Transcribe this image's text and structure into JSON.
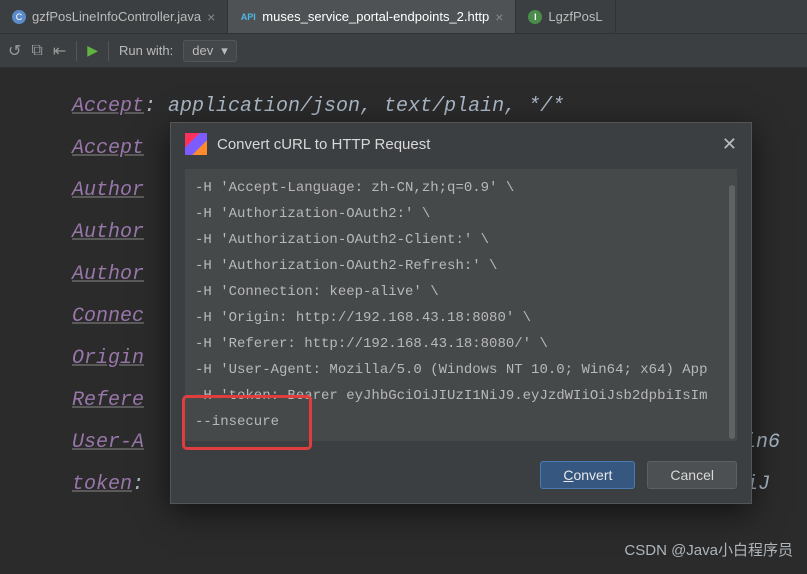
{
  "tabs": {
    "t0": {
      "label": "gzfPosLineInfoController.java"
    },
    "t1": {
      "label": "muses_service_portal-endpoints_2.http",
      "icon_text": "API"
    },
    "t2": {
      "label": "LgzfPosL"
    }
  },
  "toolbar": {
    "run_with_label": "Run with:",
    "run_config": "dev"
  },
  "editor": {
    "l0_k": "Accept",
    "l0_v": ": application/json, text/plain, */*",
    "l1_k": "Accept",
    "l2_k": "Author",
    "l3_k": "Author",
    "l4_k": "Author",
    "l5_k": "Connec",
    "l6_k": "Origin",
    "l7_k": "Refere",
    "l8_k": "User-A",
    "l8_v": "in6",
    "l9_k": "token",
    "l9_v": ":",
    "l9_end": "DiJ"
  },
  "dialog": {
    "title": "Convert cURL to HTTP Request",
    "lines": {
      "c0": "  -H 'Accept-Language: zh-CN,zh;q=0.9' \\",
      "c1": "  -H 'Authorization-OAuth2:' \\",
      "c2": "  -H 'Authorization-OAuth2-Client:' \\",
      "c3": "  -H 'Authorization-OAuth2-Refresh:' \\",
      "c4": "  -H 'Connection: keep-alive' \\",
      "c5": "  -H 'Origin: http://192.168.43.18:8080' \\",
      "c6": "  -H 'Referer: http://192.168.43.18:8080/' \\",
      "c7": "  -H 'User-Agent: Mozilla/5.0 (Windows NT 10.0; Win64; x64) App",
      "c8": "  -H 'token: Bearer eyJhbGciOiJIUzI1NiJ9.eyJzdWIiOiJsb2dpbiIsIm",
      "c9": "  --insecure"
    },
    "convert_label": "Convert",
    "cancel_label": "Cancel"
  },
  "watermark": "CSDN @Java小白程序员"
}
